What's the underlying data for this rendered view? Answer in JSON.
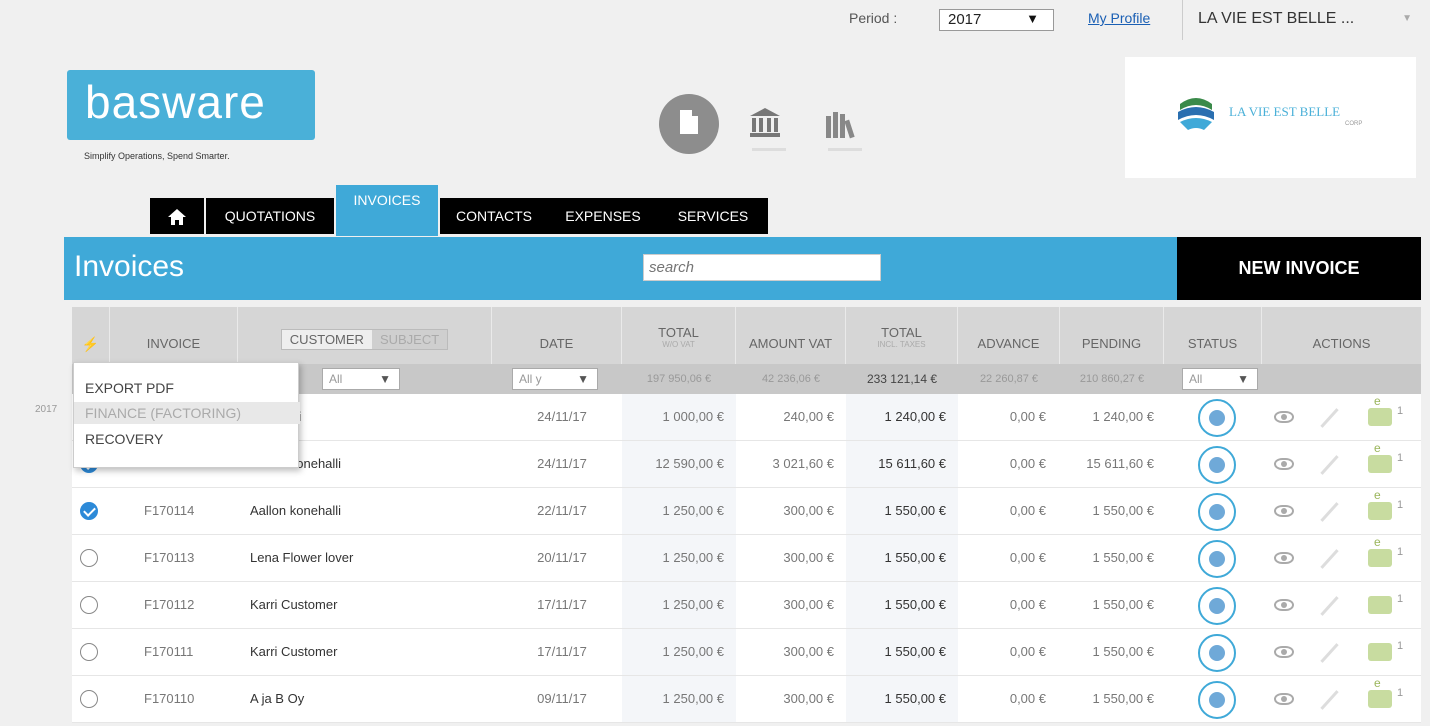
{
  "topbar": {
    "period_label": "Period :",
    "period_value": "2017",
    "my_profile": "My Profile",
    "company": "LA VIE EST BELLE ..."
  },
  "logo": {
    "brand": "basware",
    "tagline": "Simplify Operations, Spend Smarter."
  },
  "company_logo": {
    "name": "LA VIE EST BELLE",
    "sub": "CORP"
  },
  "tabs": [
    {
      "label": "QUOTATIONS"
    },
    {
      "label": "INVOICES"
    },
    {
      "label": "CONTACTS"
    },
    {
      "label": "EXPENSES"
    },
    {
      "label": "SERVICES"
    }
  ],
  "header": {
    "title": "Invoices",
    "search_placeholder": "search",
    "new_invoice": "NEW INVOICE"
  },
  "columns": {
    "invoice": "INVOICE",
    "customer": "CUSTOMER",
    "subject": "SUBJECT",
    "date": "DATE",
    "total_wo_vat": "TOTAL",
    "total_wo_vat_sub": "W/O VAT",
    "amount_vat": "AMOUNT VAT",
    "total_incl": "TOTAL",
    "total_incl_sub": "INCL. TAXES",
    "advance": "ADVANCE",
    "pending": "PENDING",
    "status": "STATUS",
    "actions": "ACTIONS"
  },
  "filters": {
    "customer": "All",
    "date": "All y",
    "total_wo_vat": "197 950,06 €",
    "amount_vat": "42 236,06 €",
    "total_incl": "233 121,14 €",
    "advance": "22 260,87 €",
    "pending": "210 860,27 €",
    "status": "All"
  },
  "menu": {
    "items": [
      "EXPORT PDF",
      "FINANCE (FACTORING)",
      "RECOVERY"
    ]
  },
  "year_marker": "2017",
  "rows": [
    {
      "checked": false,
      "invoice": "",
      "customer": "konehalli",
      "date": "24/11/17",
      "total": "1 000,00 €",
      "vat": "240,00 €",
      "incl": "1 240,00 €",
      "advance": "0,00 €",
      "pending": "1 240,00 €",
      "count": "1",
      "mail": "round"
    },
    {
      "checked": true,
      "invoice": "",
      "customer": "Aallon konehalli",
      "date": "24/11/17",
      "total": "12 590,00 €",
      "vat": "3 021,60 €",
      "incl": "15 611,60 €",
      "advance": "0,00 €",
      "pending": "15 611,60 €",
      "count": "1",
      "mail": "round"
    },
    {
      "checked": true,
      "invoice": "F170114",
      "customer": "Aallon konehalli",
      "date": "22/11/17",
      "total": "1 250,00 €",
      "vat": "300,00 €",
      "incl": "1 550,00 €",
      "advance": "0,00 €",
      "pending": "1 550,00 €",
      "count": "1",
      "mail": "round"
    },
    {
      "checked": false,
      "invoice": "F170113",
      "customer": "Lena Flower lover",
      "date": "20/11/17",
      "total": "1 250,00 €",
      "vat": "300,00 €",
      "incl": "1 550,00 €",
      "advance": "0,00 €",
      "pending": "1 550,00 €",
      "count": "1",
      "mail": "round"
    },
    {
      "checked": false,
      "invoice": "F170112",
      "customer": "Karri Customer",
      "date": "17/11/17",
      "total": "1 250,00 €",
      "vat": "300,00 €",
      "incl": "1 550,00 €",
      "advance": "0,00 €",
      "pending": "1 550,00 €",
      "count": "1",
      "mail": "envelope"
    },
    {
      "checked": false,
      "invoice": "F170111",
      "customer": "Karri Customer",
      "date": "17/11/17",
      "total": "1 250,00 €",
      "vat": "300,00 €",
      "incl": "1 550,00 €",
      "advance": "0,00 €",
      "pending": "1 550,00 €",
      "count": "1",
      "mail": "envelope"
    },
    {
      "checked": false,
      "invoice": "F170110",
      "customer": "A ja B Oy",
      "date": "09/11/17",
      "total": "1 250,00 €",
      "vat": "300,00 €",
      "incl": "1 550,00 €",
      "advance": "0,00 €",
      "pending": "1 550,00 €",
      "count": "1",
      "mail": "round"
    }
  ]
}
